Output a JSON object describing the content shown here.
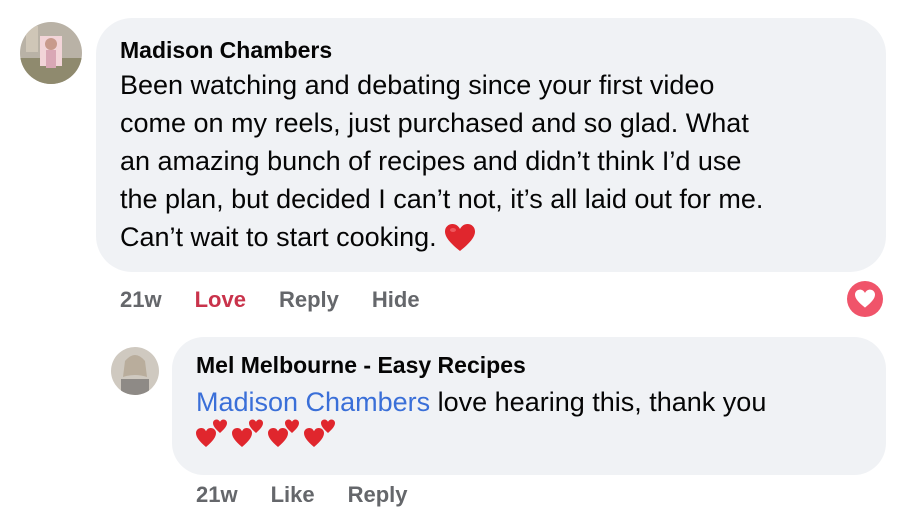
{
  "comment": {
    "author": "Madison Chambers",
    "text": "Been watching and debating since your first video\ncome on my reels, just purchased and so glad. What\nan amazing bunch of recipes and didn’t think I’d use\nthe plan, but decided I can’t not, it’s all laid out for me.\nCan’t wait to start cooking.",
    "emoji_icon": "red-heart-icon",
    "time": "21w",
    "reaction_label": "Love",
    "reply_label": "Reply",
    "hide_label": "Hide",
    "reaction_badge_icon": "love-reaction-icon",
    "colors": {
      "love": "#c9334b",
      "bubble": "#f0f2f5",
      "meta": "#65676b"
    }
  },
  "reply": {
    "author": "Mel Melbourne - Easy Recipes",
    "mention": "Madison Chambers",
    "text": "love hearing this, thank you",
    "emoji_icon": "two-hearts-icon",
    "emoji_count": 4,
    "time": "21w",
    "like_label": "Like",
    "reply_label": "Reply",
    "colors": {
      "mention": "#3a6fd8"
    }
  }
}
